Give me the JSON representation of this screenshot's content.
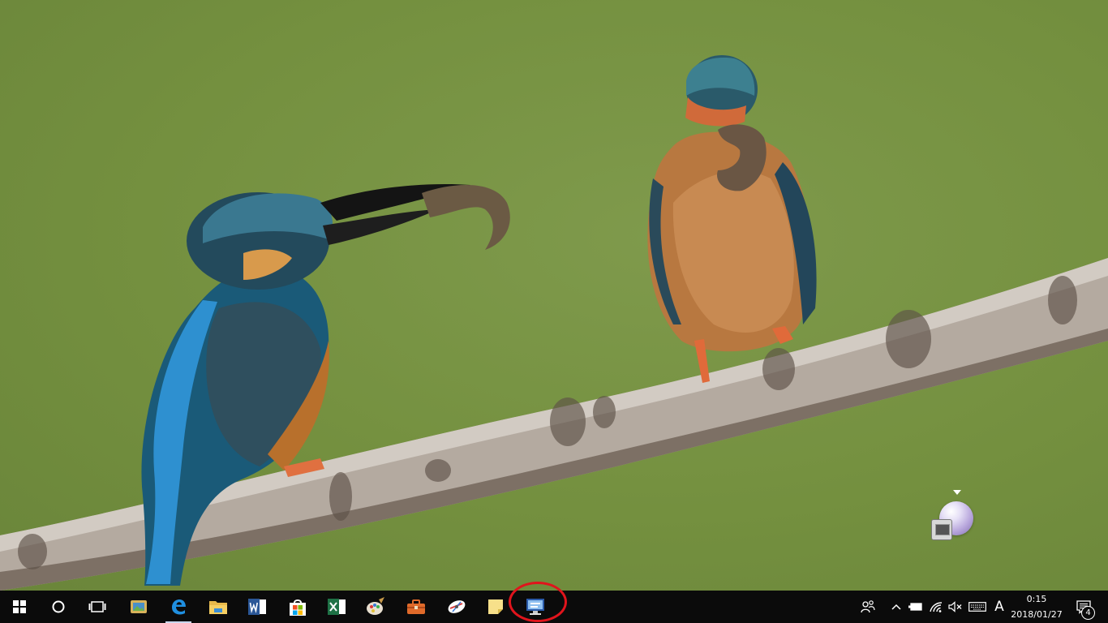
{
  "desktop": {
    "wallpaper_icon": "kingfisher-photo",
    "widget_icon": "gadget-orb-icon"
  },
  "taskbar": {
    "start_icon": "windows-logo-icon",
    "pinned": [
      {
        "name": "cortana-icon"
      },
      {
        "name": "task-view-icon"
      },
      {
        "name": "photos-app-icon"
      },
      {
        "name": "edge-icon",
        "active": true
      },
      {
        "name": "file-explorer-icon"
      },
      {
        "name": "word-icon"
      },
      {
        "name": "store-icon"
      },
      {
        "name": "excel-icon"
      },
      {
        "name": "paint-app-icon"
      },
      {
        "name": "toolbox-app-icon"
      },
      {
        "name": "satellite-app-icon"
      },
      {
        "name": "sticky-notes-icon"
      },
      {
        "name": "remote-desktop-icon",
        "highlighted": true
      }
    ],
    "colors": {
      "background": "#0b0b0b",
      "highlight_ring": "#e0141c"
    }
  },
  "tray": {
    "ime_label": "A",
    "clock": {
      "time": "0:15",
      "date": "2018/01/27"
    },
    "notification_count": "4",
    "icons": [
      "people-icon",
      "show-hidden-icons-icon",
      "battery-icon",
      "wifi-icon",
      "volume-muted-icon",
      "touch-keyboard-icon",
      "action-center-icon"
    ]
  }
}
